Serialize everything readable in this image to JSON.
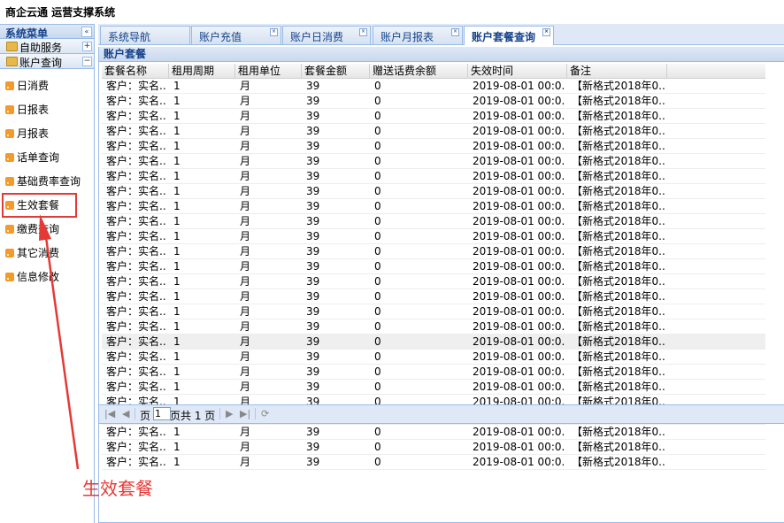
{
  "app": {
    "title": "商企云通 运营支撑系统"
  },
  "sidebar": {
    "title": "系统菜单",
    "collapse_glyph": "«",
    "groups": [
      {
        "label": "自助服务",
        "toggle": "+"
      },
      {
        "label": "账户查询",
        "toggle": "−"
      }
    ],
    "items": [
      {
        "label": "日消费"
      },
      {
        "label": "日报表"
      },
      {
        "label": "月报表"
      },
      {
        "label": "话单查询"
      },
      {
        "label": "基础费率查询"
      },
      {
        "label": "生效套餐"
      },
      {
        "label": "缴费查询"
      },
      {
        "label": "其它消费"
      },
      {
        "label": "信息修改"
      }
    ]
  },
  "tabs": [
    {
      "label": "系统导航"
    },
    {
      "label": "账户充值"
    },
    {
      "label": "账户日消费"
    },
    {
      "label": "账户月报表"
    },
    {
      "label": "账户套餐查询",
      "active": true
    }
  ],
  "panel": {
    "title": "账户套餐"
  },
  "grid": {
    "columns": [
      "套餐名称",
      "租用周期",
      "租用单位",
      "套餐金额",
      "赠送话费余额",
      "失效时间",
      "备注"
    ],
    "row": [
      "客户：实名...",
      "1",
      "月",
      "39",
      "0",
      "2019-08-01 00:0...",
      "【新格式2018年0..."
    ],
    "row_count": 26,
    "selected_row": 17
  },
  "pager": {
    "page_label": "页",
    "page_value": "1",
    "total_label": "页共 1 页"
  },
  "annotation": {
    "text": "生效套餐",
    "color": "#e53935"
  },
  "colors": {
    "accent": "#15428b",
    "border": "#99bbe8",
    "annotation": "#e53935"
  }
}
